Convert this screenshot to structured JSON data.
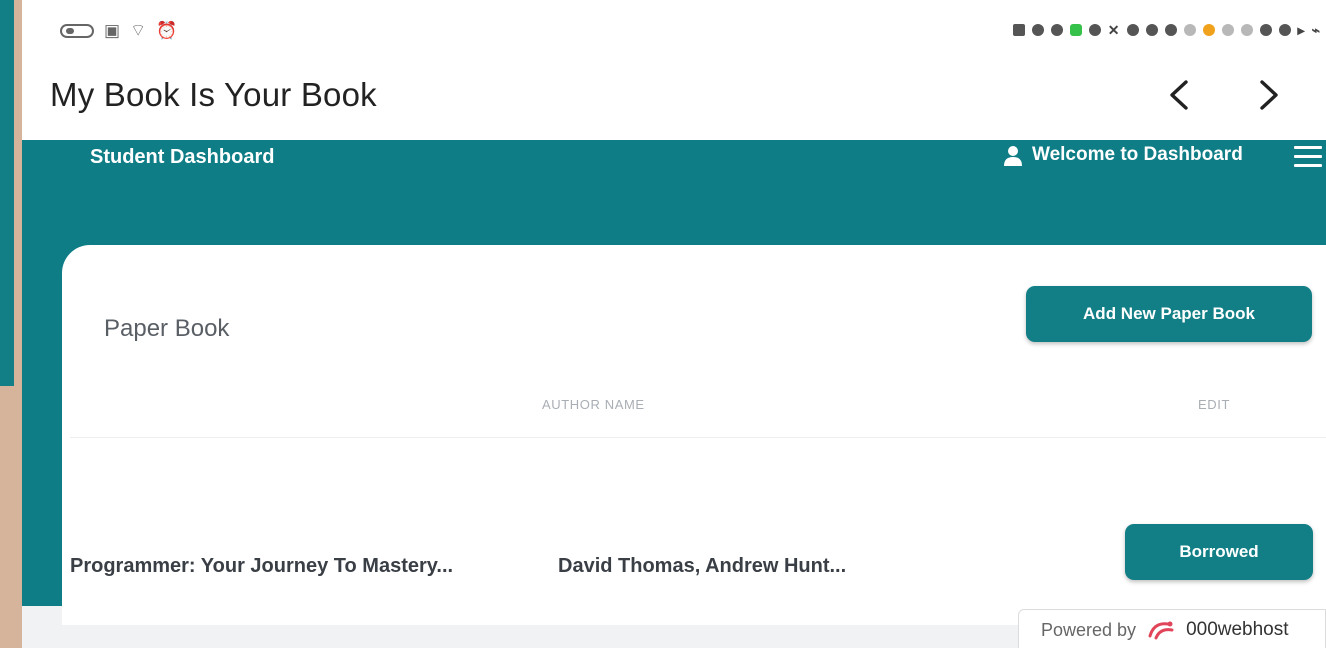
{
  "app": {
    "title": "My Book Is Your Book"
  },
  "header": {
    "brand": "Student Dashboard",
    "welcome": "Welcome to Dashboard"
  },
  "card": {
    "title": "Paper Book",
    "add_button": "Add New Paper Book",
    "columns": [
      "AUTHOR NAME",
      "EDIT"
    ],
    "rows": [
      {
        "title": "Programmer: Your Journey To Mastery...",
        "author": "David Thomas, Andrew Hunt...",
        "action": "Borrowed"
      }
    ]
  },
  "footer": {
    "powered_by": "Powered by",
    "host": "000webhost"
  },
  "colors": {
    "primary": "#0e7d86",
    "button": "#127f86",
    "background": "#d6b49c"
  }
}
